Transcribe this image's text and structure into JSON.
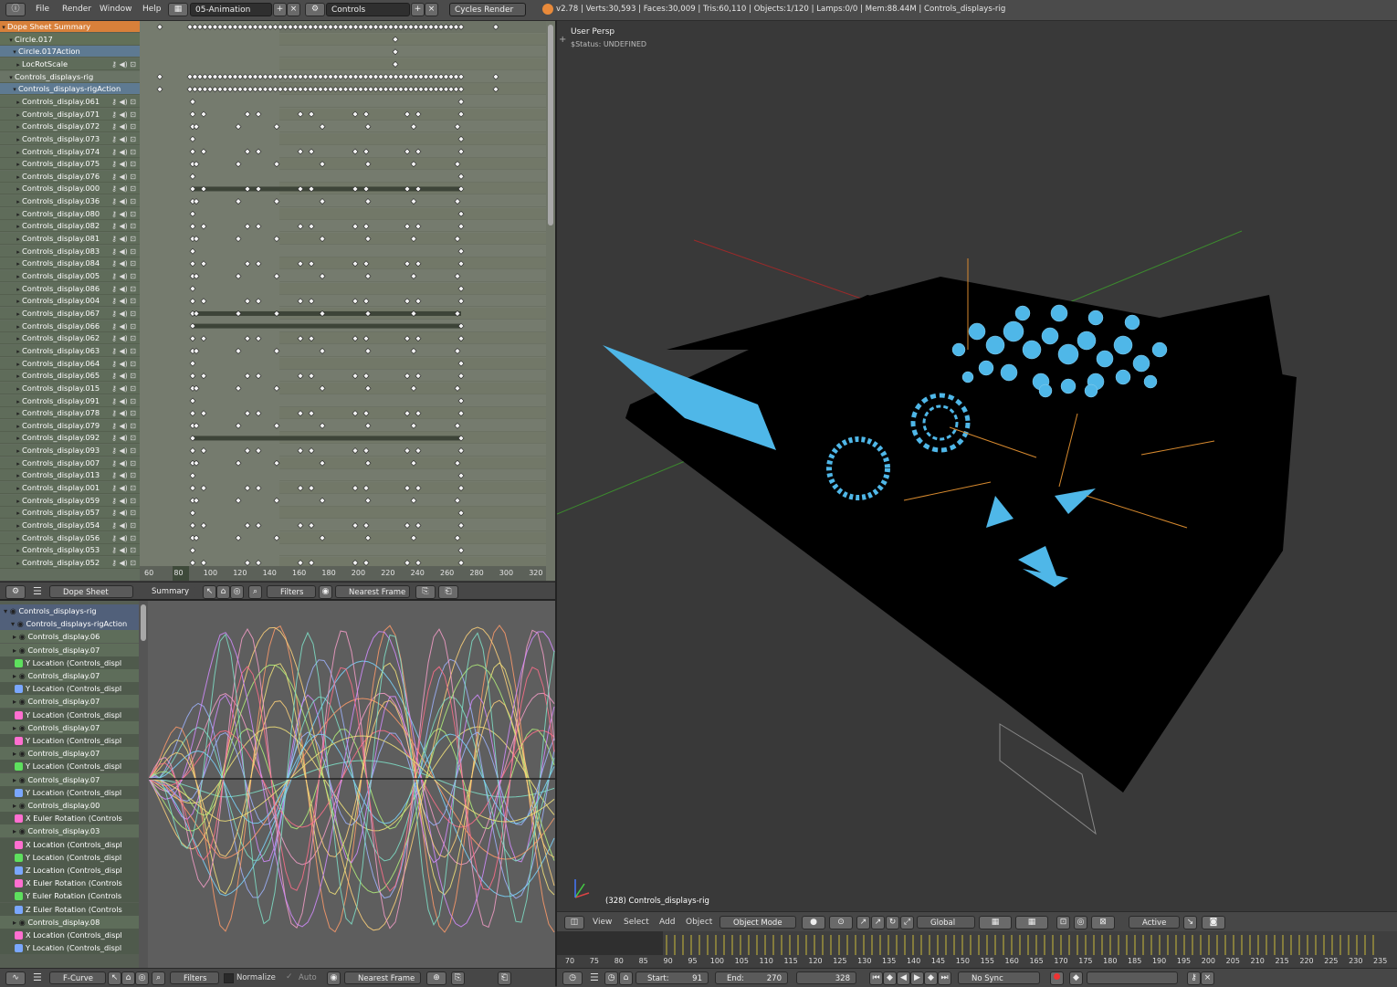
{
  "topbar": {
    "menus": [
      "File",
      "Render",
      "Window",
      "Help"
    ],
    "screen": "05-Animation",
    "scene": "Controls",
    "engine": "Cycles Render",
    "stats": "v2.78 | Verts:30,593 | Faces:30,009 | Tris:60,110 | Objects:1/120 | Lamps:0/0 | Mem:88.44M | Controls_displays-rig"
  },
  "dopesheet": {
    "channels": [
      {
        "label": "Dope Sheet Summary",
        "kind": "summary"
      },
      {
        "label": "Circle.017",
        "kind": "object"
      },
      {
        "label": "Circle.017Action",
        "kind": "action"
      },
      {
        "label": "LocRotScale",
        "kind": "group"
      },
      {
        "label": "Controls_displays-rig",
        "kind": "object2"
      },
      {
        "label": "Controls_displays-rigAction",
        "kind": "action"
      },
      {
        "label": "Controls_display.061",
        "kind": "group"
      },
      {
        "label": "Controls_display.071",
        "kind": "group"
      },
      {
        "label": "Controls_display.072",
        "kind": "group"
      },
      {
        "label": "Controls_display.073",
        "kind": "group"
      },
      {
        "label": "Controls_display.074",
        "kind": "group"
      },
      {
        "label": "Controls_display.075",
        "kind": "group"
      },
      {
        "label": "Controls_display.076",
        "kind": "group"
      },
      {
        "label": "Controls_display.000",
        "kind": "group"
      },
      {
        "label": "Controls_display.036",
        "kind": "group"
      },
      {
        "label": "Controls_display.080",
        "kind": "group"
      },
      {
        "label": "Controls_display.082",
        "kind": "group"
      },
      {
        "label": "Controls_display.081",
        "kind": "group"
      },
      {
        "label": "Controls_display.083",
        "kind": "group"
      },
      {
        "label": "Controls_display.084",
        "kind": "group"
      },
      {
        "label": "Controls_display.005",
        "kind": "group"
      },
      {
        "label": "Controls_display.086",
        "kind": "group"
      },
      {
        "label": "Controls_display.004",
        "kind": "group"
      },
      {
        "label": "Controls_display.067",
        "kind": "group"
      },
      {
        "label": "Controls_display.066",
        "kind": "group"
      },
      {
        "label": "Controls_display.062",
        "kind": "group"
      },
      {
        "label": "Controls_display.063",
        "kind": "group"
      },
      {
        "label": "Controls_display.064",
        "kind": "group"
      },
      {
        "label": "Controls_display.065",
        "kind": "group"
      },
      {
        "label": "Controls_display.015",
        "kind": "group"
      },
      {
        "label": "Controls_display.091",
        "kind": "group"
      },
      {
        "label": "Controls_display.078",
        "kind": "group"
      },
      {
        "label": "Controls_display.079",
        "kind": "group"
      },
      {
        "label": "Controls_display.092",
        "kind": "group"
      },
      {
        "label": "Controls_display.093",
        "kind": "group"
      },
      {
        "label": "Controls_display.007",
        "kind": "group"
      },
      {
        "label": "Controls_display.013",
        "kind": "group"
      },
      {
        "label": "Controls_display.001",
        "kind": "group"
      },
      {
        "label": "Controls_display.059",
        "kind": "group"
      },
      {
        "label": "Controls_display.057",
        "kind": "group"
      },
      {
        "label": "Controls_display.054",
        "kind": "group"
      },
      {
        "label": "Controls_display.056",
        "kind": "group"
      },
      {
        "label": "Controls_display.053",
        "kind": "group"
      },
      {
        "label": "Controls_display.052",
        "kind": "group"
      }
    ],
    "ruler": [
      "60",
      "80",
      "100",
      "120",
      "140",
      "160",
      "180",
      "200",
      "220",
      "240",
      "260",
      "280",
      "300",
      "320"
    ],
    "header": {
      "editor": "Dope Sheet",
      "mode": "Summary",
      "filters": "Filters",
      "snap": "Nearest Frame"
    }
  },
  "graph": {
    "channels": [
      {
        "label": "Controls_displays-rig",
        "color": ""
      },
      {
        "label": "Controls_displays-rigAction",
        "color": ""
      },
      {
        "label": "Controls_display.06",
        "color": ""
      },
      {
        "label": "Controls_display.07",
        "color": ""
      },
      {
        "label": "Y Location (Controls_displ",
        "color": "#5ee05e"
      },
      {
        "label": "Controls_display.07",
        "color": ""
      },
      {
        "label": "Y Location (Controls_displ",
        "color": "#7aa7ff"
      },
      {
        "label": "Controls_display.07",
        "color": ""
      },
      {
        "label": "Y Location (Controls_displ",
        "color": "#ff6fd0"
      },
      {
        "label": "Controls_display.07",
        "color": ""
      },
      {
        "label": "Y Location (Controls_displ",
        "color": "#ff6fd0"
      },
      {
        "label": "Controls_display.07",
        "color": ""
      },
      {
        "label": "Y Location (Controls_displ",
        "color": "#5ee05e"
      },
      {
        "label": "Controls_display.07",
        "color": ""
      },
      {
        "label": "Y Location (Controls_displ",
        "color": "#7aa7ff"
      },
      {
        "label": "Controls_display.00",
        "color": ""
      },
      {
        "label": "X Euler Rotation (Controls",
        "color": "#ff6fd0"
      },
      {
        "label": "Controls_display.03",
        "color": ""
      },
      {
        "label": "X Location (Controls_displ",
        "color": "#ff6fd0"
      },
      {
        "label": "Y Location (Controls_displ",
        "color": "#5ee05e"
      },
      {
        "label": "Z Location (Controls_displ",
        "color": "#7aa7ff"
      },
      {
        "label": "X Euler Rotation (Controls",
        "color": "#ff6fd0"
      },
      {
        "label": "Y Euler Rotation (Controls",
        "color": "#5ee05e"
      },
      {
        "label": "Z Euler Rotation (Controls",
        "color": "#7aa7ff"
      },
      {
        "label": "Controls_display.08",
        "color": ""
      },
      {
        "label": "X Location (Controls_displ",
        "color": "#ff6fd0"
      },
      {
        "label": "Y Location (Controls_displ",
        "color": "#7aa7ff"
      }
    ],
    "header": {
      "editor": "F-Curve",
      "filters": "Filters",
      "normalize": "Normalize",
      "auto": "Auto",
      "snap": "Nearest Frame"
    }
  },
  "viewport": {
    "view_name": "User Persp",
    "status": "$Status: UNDEFINED",
    "object_label": "(328) Controls_displays-rig",
    "header": {
      "view": "View",
      "select": "Select",
      "add": "Add",
      "object": "Object",
      "mode": "Object Mode",
      "orientation": "Global",
      "pivot_active": "Active"
    }
  },
  "timeline": {
    "ticks": [
      "70",
      "75",
      "80",
      "85",
      "90",
      "95",
      "100",
      "105",
      "110",
      "115",
      "120",
      "125",
      "130",
      "135",
      "140",
      "145",
      "150",
      "155",
      "160",
      "165",
      "170",
      "175",
      "180",
      "185",
      "190",
      "195",
      "200",
      "205",
      "210",
      "215",
      "220",
      "225",
      "230",
      "235"
    ],
    "start_label": "Start:",
    "start": "91",
    "end_label": "End:",
    "end": "270",
    "current": "328",
    "sync": "No Sync"
  },
  "colors": {
    "summary": "#d8803a",
    "object": "#b7874f",
    "action": "#5e7a92",
    "group": "#5a6a55",
    "accent": "#4fb7e8"
  }
}
